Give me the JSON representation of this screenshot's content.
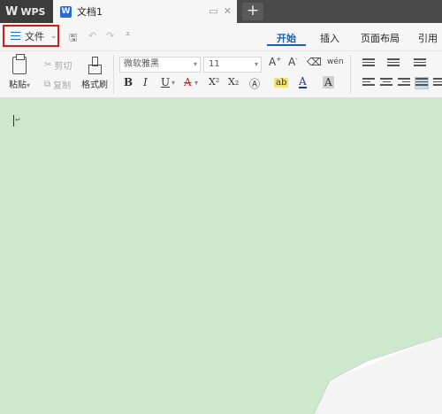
{
  "titlebar": {
    "app_name": "WPS",
    "doc_tab_title": "文档1",
    "doc_icon_letter": "W",
    "new_tab_label": "+"
  },
  "menubar": {
    "file_label": "文件",
    "tabs": [
      {
        "label": "开始",
        "active": true
      },
      {
        "label": "插入",
        "active": false
      },
      {
        "label": "页面布局",
        "active": false
      },
      {
        "label": "引用",
        "active": false
      }
    ]
  },
  "ribbon": {
    "paste_label": "粘贴",
    "cut_label": "剪切",
    "copy_label": "复制",
    "format_painter_label": "格式刷",
    "font_name": "微软雅黑",
    "font_size": "11",
    "bold": "B",
    "italic": "I",
    "underline": "U",
    "strikethrough": "A",
    "superscript": "X²",
    "subscript": "X₂",
    "font_color": "A",
    "char_shading": "A",
    "phonetic": "wén"
  },
  "colors": {
    "accent": "#1a5fb4",
    "highlight_red": "#d21d1d",
    "page_bg": "#cde9cd"
  }
}
